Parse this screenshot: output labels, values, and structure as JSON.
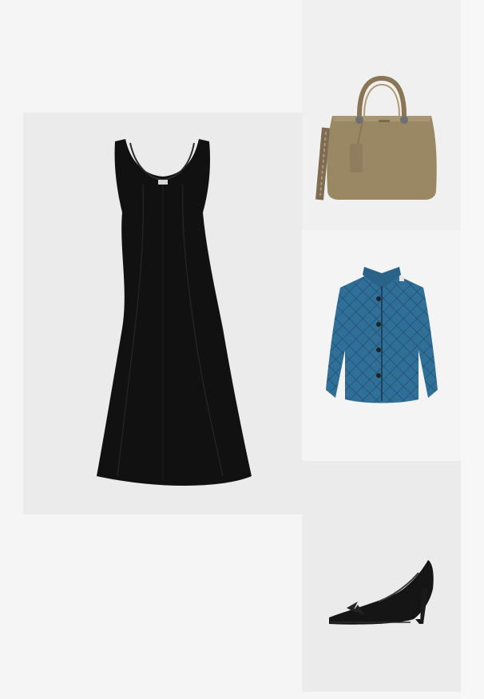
{
  "outfit": {
    "items": [
      {
        "id": "dress",
        "icon": "black-midi-dress-image"
      },
      {
        "id": "bag",
        "icon": "taupe-tote-bag-image"
      },
      {
        "id": "jacket",
        "icon": "quilted-denim-jacket-image"
      },
      {
        "id": "shoe",
        "icon": "black-pointed-pump-image"
      }
    ],
    "colors": {
      "page_background": "#f5f5f5",
      "tile_background": "#ebebeb",
      "dress": "#111111",
      "bag": "#9a8865",
      "jacket": "#2f6f98",
      "shoe": "#151515"
    }
  }
}
